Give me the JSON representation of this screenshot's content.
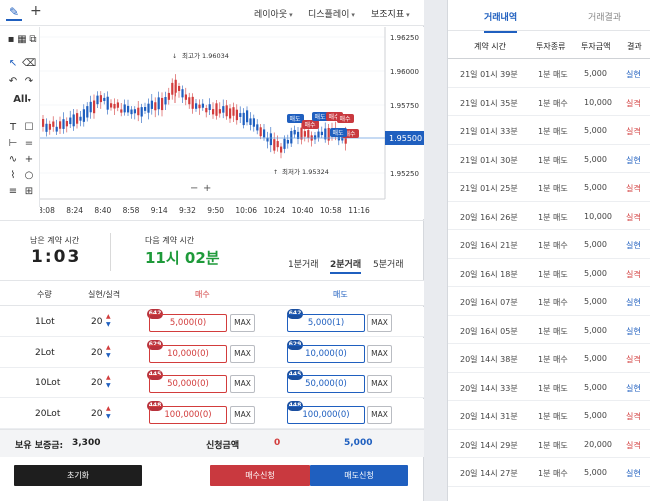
{
  "toolbar": {
    "menus": [
      "레이아웃",
      "디스플레이",
      "보조지표"
    ],
    "all_label": "All"
  },
  "chart": {
    "y_ticks": [
      "1.96250",
      "1.96000",
      "1.95750",
      "1.95500",
      "1.95250"
    ],
    "current_price": "1.95500",
    "x_ticks": [
      "8:08",
      "8:24",
      "8:40",
      "8:58",
      "9:14",
      "9:32",
      "9:50",
      "10:06",
      "10:24",
      "10:40",
      "10:58",
      "11:16"
    ],
    "high_label": "최고가 1.96034",
    "low_label": "최저가 1.95324",
    "trade_tags": [
      "매도",
      "매수",
      "매도",
      "매수",
      "매수",
      "매도",
      "매수"
    ],
    "zoom_minus": "−",
    "zoom_plus": "+"
  },
  "timer": {
    "remaining_label": "남은 계약 시간",
    "remaining_value": "1:03",
    "next_label": "다음 계약 시간",
    "next_value": "11시 02분"
  },
  "periods": [
    "1분거래",
    "2분거래",
    "5분거래"
  ],
  "order_table": {
    "headers": {
      "qty": "수량",
      "realized": "실현/실격",
      "buy": "매수",
      "sell": "매도"
    },
    "max_label": "MAX",
    "rows": [
      {
        "lot": "1Lot",
        "count": "20",
        "buy_badge": "642",
        "buy_amount": "5,000(0)",
        "sell_badge": "642",
        "sell_amount": "5,000(1)"
      },
      {
        "lot": "2Lot",
        "count": "20",
        "buy_badge": "629",
        "buy_amount": "10,000(0)",
        "sell_badge": "629",
        "sell_amount": "10,000(0)"
      },
      {
        "lot": "10Lot",
        "count": "20",
        "buy_badge": "445",
        "buy_amount": "50,000(0)",
        "sell_badge": "445",
        "sell_amount": "50,000(0)"
      },
      {
        "lot": "20Lot",
        "count": "20",
        "buy_badge": "448",
        "buy_amount": "100,000(0)",
        "sell_badge": "448",
        "sell_amount": "100,000(0)"
      }
    ]
  },
  "summary": {
    "margin_label": "보유 보증금:",
    "margin_value": "3,300",
    "apply_label": "신청금액",
    "buy_total": "0",
    "sell_total": "5,000"
  },
  "buttons": {
    "reset": "초기화",
    "buy": "매수신청",
    "sell": "매도신청"
  },
  "colors": {
    "buy": "#d23c3c",
    "sell": "#1f5fbf",
    "accent_green": "#1e9a3a"
  },
  "history": {
    "tabs": [
      "거래내역",
      "거래결과"
    ],
    "headers": [
      "계약 시간",
      "투자종류",
      "투자금액",
      "결과"
    ],
    "rows": [
      {
        "time": "21일 01시 39분",
        "type": "1분 매도",
        "amount": "5,000",
        "result": "실현"
      },
      {
        "time": "21일 01시 35분",
        "type": "1분 매수",
        "amount": "10,000",
        "result": "실격"
      },
      {
        "time": "21일 01시 33분",
        "type": "1분 매도",
        "amount": "5,000",
        "result": "실격"
      },
      {
        "time": "21일 01시 30분",
        "type": "1분 매도",
        "amount": "5,000",
        "result": "실현"
      },
      {
        "time": "21일 01시 25분",
        "type": "1분 매도",
        "amount": "5,000",
        "result": "실격"
      },
      {
        "time": "20일 16시 26분",
        "type": "1분 매도",
        "amount": "10,000",
        "result": "실격"
      },
      {
        "time": "20일 16시 21분",
        "type": "1분 매수",
        "amount": "5,000",
        "result": "실현"
      },
      {
        "time": "20일 16시 18분",
        "type": "1분 매도",
        "amount": "5,000",
        "result": "실격"
      },
      {
        "time": "20일 16시 07분",
        "type": "1분 매수",
        "amount": "5,000",
        "result": "실현"
      },
      {
        "time": "20일 16시 05분",
        "type": "1분 매도",
        "amount": "5,000",
        "result": "실현"
      },
      {
        "time": "20일 14시 38분",
        "type": "1분 매수",
        "amount": "5,000",
        "result": "실격"
      },
      {
        "time": "20일 14시 33분",
        "type": "1분 매도",
        "amount": "5,000",
        "result": "실현"
      },
      {
        "time": "20일 14시 31분",
        "type": "1분 매도",
        "amount": "5,000",
        "result": "실격"
      },
      {
        "time": "20일 14시 29분",
        "type": "1분 매도",
        "amount": "20,000",
        "result": "실격"
      },
      {
        "time": "20일 14시 27분",
        "type": "1분 매수",
        "amount": "5,000",
        "result": "실현"
      }
    ]
  }
}
